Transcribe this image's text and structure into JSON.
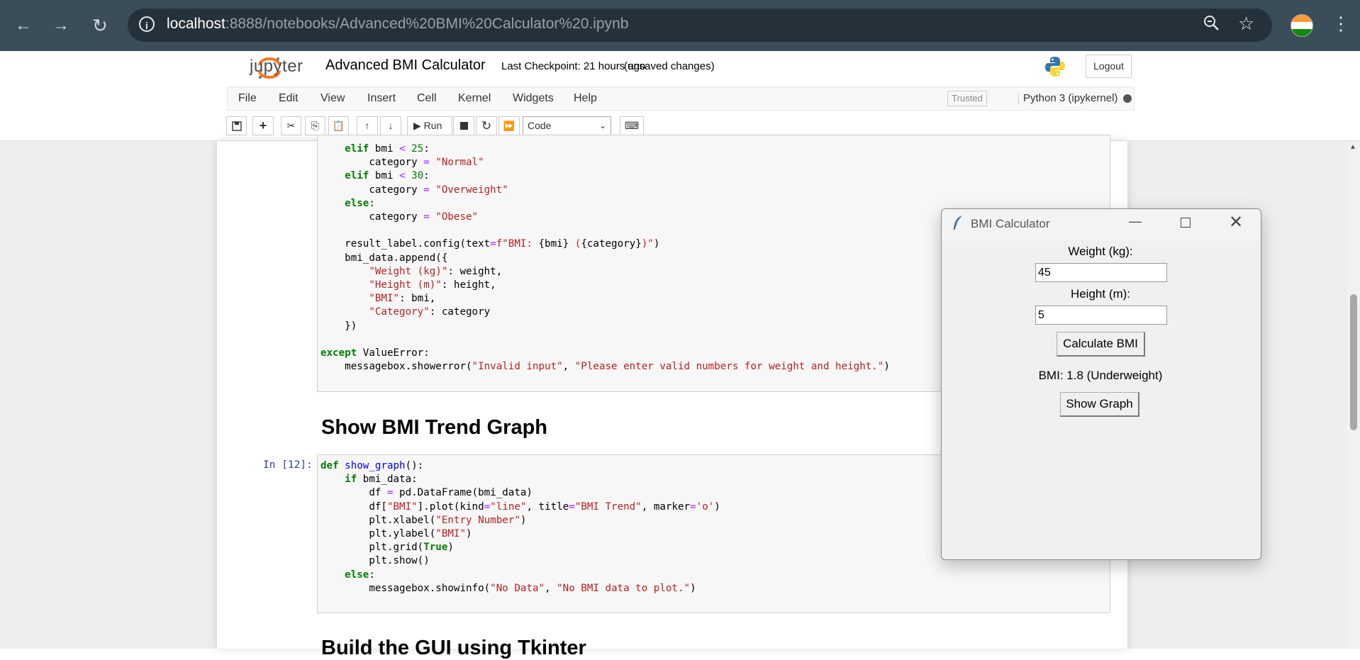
{
  "browser": {
    "url_host": "localhost",
    "url_rest": ":8888/notebooks/Advanced%20BMI%20Calculator%20.ipynb"
  },
  "jupyter": {
    "logo_text": "jupyter",
    "notebook_title": "Advanced BMI Calculator",
    "checkpoint": "Last Checkpoint: 21 hours ago",
    "unsaved": "(unsaved changes)",
    "logout_label": "Logout",
    "menu": [
      "File",
      "Edit",
      "View",
      "Insert",
      "Cell",
      "Kernel",
      "Widgets",
      "Help"
    ],
    "trusted_label": "Trusted",
    "kernel_name": "Python 3 (ipykernel)",
    "run_label": "Run",
    "cell_type": "Code"
  },
  "cells": {
    "cell1_code": [
      "    elif bmi < 25:",
      "        category = \"Normal\"",
      "    elif bmi < 30:",
      "        category = \"Overweight\"",
      "    else:",
      "        category = \"Obese\"",
      "",
      "    result_label.config(text=f\"BMI: {bmi} ({category})\")",
      "    bmi_data.append({",
      "        \"Weight (kg)\": weight,",
      "        \"Height (m)\": height,",
      "        \"BMI\": bmi,",
      "        \"Category\": category",
      "    })",
      "",
      "except ValueError:",
      "    messagebox.showerror(\"Invalid input\", \"Please enter valid numbers for weight and height.\")"
    ],
    "heading1": "Show BMI Trend Graph",
    "cell2_prompt": "In [12]:",
    "cell2_code": [
      "def show_graph():",
      "    if bmi_data:",
      "        df = pd.DataFrame(bmi_data)",
      "        df[\"BMI\"].plot(kind=\"line\", title=\"BMI Trend\", marker='o')",
      "        plt.xlabel(\"Entry Number\")",
      "        plt.ylabel(\"BMI\")",
      "        plt.grid(True)",
      "        plt.show()",
      "    else:",
      "        messagebox.showinfo(\"No Data\", \"No BMI data to plot.\")"
    ],
    "heading2": "Build the GUI using Tkinter"
  },
  "tk_window": {
    "title": "BMI Calculator",
    "weight_label": "Weight (kg):",
    "weight_value": "45",
    "height_label": "Height (m):",
    "height_value": "5",
    "calculate_label": "Calculate BMI",
    "result_text": "BMI: 1.8 (Underweight)",
    "show_graph_label": "Show Graph"
  }
}
